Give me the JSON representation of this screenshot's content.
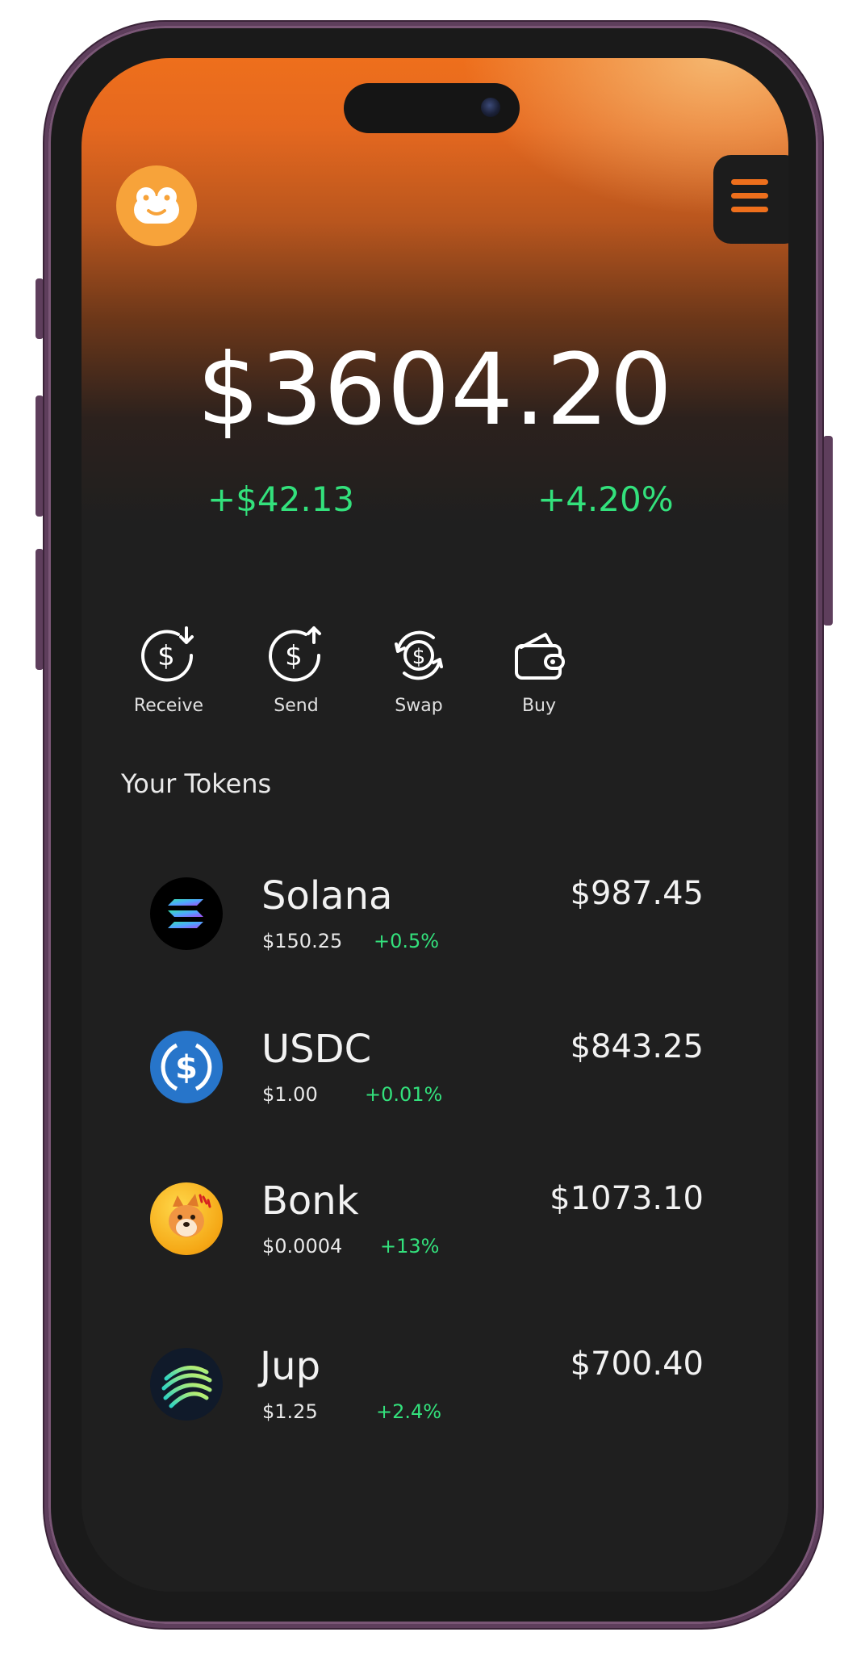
{
  "wallet": {
    "balance": "$3604.20",
    "change_amount": "+$42.13",
    "change_percent": "+4.20%"
  },
  "actions": [
    {
      "label": "Receive",
      "icon": "receive-icon"
    },
    {
      "label": "Send",
      "icon": "send-icon"
    },
    {
      "label": "Swap",
      "icon": "swap-icon"
    },
    {
      "label": "Buy",
      "icon": "wallet-icon"
    }
  ],
  "tokens_section": {
    "title": "Your Tokens"
  },
  "tokens": [
    {
      "name": "Solana",
      "price": "$150.25",
      "change": "+0.5%",
      "value": "$987.45",
      "icon": "solana-logo"
    },
    {
      "name": "USDC",
      "price": "$1.00",
      "change": "+0.01%",
      "value": "$843.25",
      "icon": "usdc-logo"
    },
    {
      "name": "Bonk",
      "price": "$0.0004",
      "change": "+13%",
      "value": "$1073.10",
      "icon": "bonk-logo"
    },
    {
      "name": "Jup",
      "price": "$1.25",
      "change": "+2.4%",
      "value": "$700.40",
      "icon": "jup-logo"
    }
  ],
  "colors": {
    "accent": "#F7A33A",
    "positive": "#33E17C",
    "background": "#1F1F1F",
    "frame": "#5E3E5C"
  }
}
